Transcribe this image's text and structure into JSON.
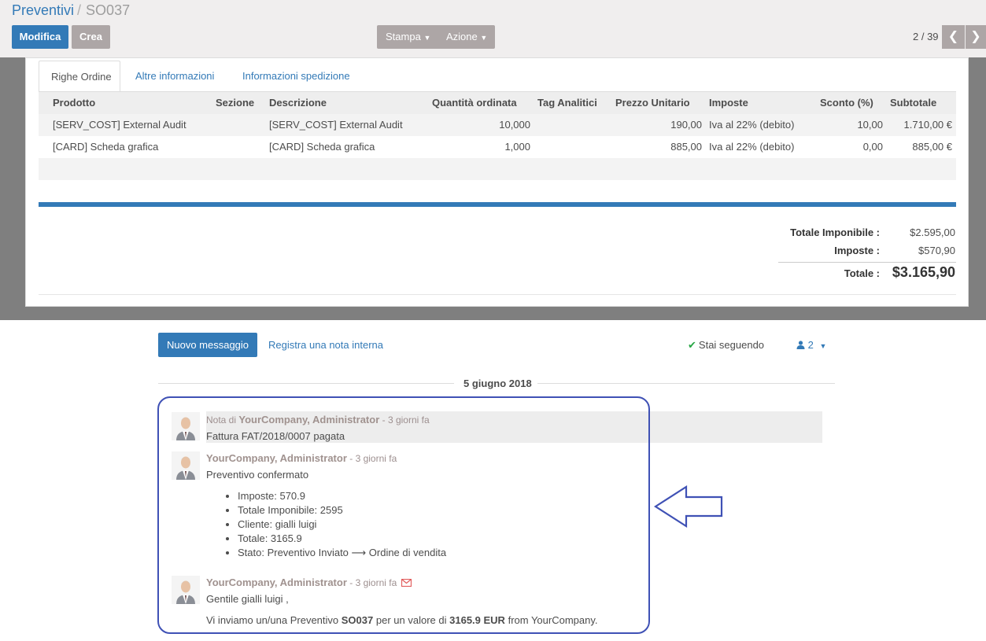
{
  "breadcrumb": {
    "parent": "Preventivi",
    "separator": "/",
    "current": "SO037"
  },
  "toolbar": {
    "edit": "Modifica",
    "create": "Crea",
    "print": "Stampa",
    "action": "Azione"
  },
  "pager": {
    "value": "2 / 39"
  },
  "tabs": [
    "Righe Ordine",
    "Altre informazioni",
    "Informazioni spedizione"
  ],
  "table": {
    "headers": [
      "Prodotto",
      "Sezione",
      "Descrizione",
      "Quantità ordinata",
      "Tag Analitici",
      "Prezzo Unitario",
      "Imposte",
      "Sconto (%)",
      "Subtotale"
    ],
    "rows": [
      {
        "product": "[SERV_COST] External Audit",
        "section": "",
        "description": "[SERV_COST] External Audit",
        "qty": "10,000",
        "tags": "",
        "price": "190,00",
        "taxes": "Iva al 22% (debito)",
        "discount": "10,00",
        "subtotal": "1.710,00 €"
      },
      {
        "product": "[CARD] Scheda grafica",
        "section": "",
        "description": "[CARD] Scheda grafica",
        "qty": "1,000",
        "tags": "",
        "price": "885,00",
        "taxes": "Iva al 22% (debito)",
        "discount": "0,00",
        "subtotal": "885,00 €"
      }
    ]
  },
  "totals": {
    "untaxed_label": "Totale Imponibile :",
    "untaxed": "$2.595,00",
    "tax_label": "Imposte :",
    "tax": "$570,90",
    "total_label": "Totale :",
    "total": "$3.165,90"
  },
  "chatter": {
    "new_message": "Nuovo messaggio",
    "log_note": "Registra una nota interna",
    "following": "Stai seguendo",
    "followers_count": "2",
    "date": "5 giugno 2018",
    "messages": [
      {
        "prefix": "Nota di",
        "author": "YourCompany, Administrator",
        "time": "- 3 giorni fa",
        "body": "Fattura FAT/2018/0007 pagata"
      },
      {
        "author": "YourCompany, Administrator",
        "time": "- 3 giorni fa",
        "body": "Preventivo confermato",
        "values": [
          "Imposte: 570.9",
          "Totale Imponibile: 2595",
          "Cliente: gialli luigi",
          "Totale: 3165.9",
          "Stato: Preventivo Inviato ⟶ Ordine di vendita"
        ]
      },
      {
        "author": "YourCompany, Administrator",
        "time": "- 3 giorni fa",
        "greeting": "Gentile gialli luigi ,",
        "line_pre": "Vi inviamo un/una Preventivo",
        "line_ref": "SO037",
        "line_mid": "per un valore di",
        "line_amount": "3165.9 EUR",
        "line_post": "from YourCompany."
      }
    ]
  },
  "colors": {
    "primary": "#337ab7",
    "secondary_button": "#ada6a6",
    "annotation": "#3f51b5"
  }
}
